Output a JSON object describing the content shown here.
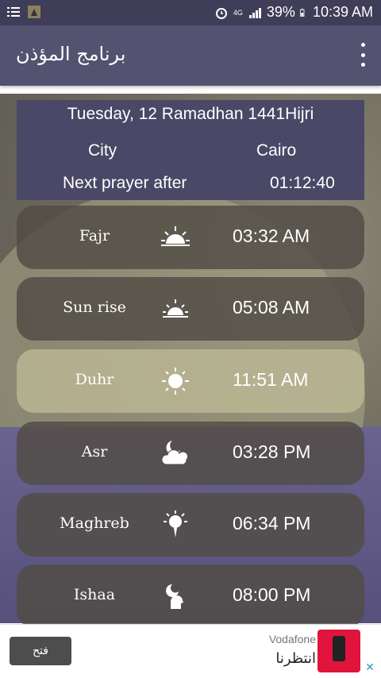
{
  "status_bar": {
    "battery": "39%",
    "time": "10:39 AM",
    "network": "4G",
    "icons": [
      "list-icon",
      "app-thumbnail-icon",
      "alarm-icon",
      "signal-icon",
      "battery-icon"
    ]
  },
  "app_bar": {
    "title": "برنامج المؤذن",
    "menu_icon": "overflow-menu-icon"
  },
  "info": {
    "date": "Tuesday, 12 Ramadhan 1441Hijri",
    "city_label": "City",
    "city_value": "Cairo",
    "next_label": "Next prayer after",
    "next_value": "01:12:40"
  },
  "prayers": [
    {
      "name": "Fajr",
      "time": "03:32 AM",
      "icon": "sunrise-icon",
      "active": false
    },
    {
      "name": "Sun rise",
      "time": "05:08 AM",
      "icon": "sunrise-icon",
      "active": false
    },
    {
      "name": "Duhr",
      "time": "11:51 AM",
      "icon": "sun-icon",
      "active": true
    },
    {
      "name": "Asr",
      "time": "03:28 PM",
      "icon": "cloud-moon-icon",
      "active": false
    },
    {
      "name": "Maghreb",
      "time": "06:34 PM",
      "icon": "sunset-icon",
      "active": false
    },
    {
      "name": "Ishaa",
      "time": "08:00 PM",
      "icon": "moon-head-icon",
      "active": false
    }
  ],
  "ad": {
    "button_label": "فتح",
    "brand": "Vodafone",
    "message": "انتظرنا",
    "close_icon": "close-icon"
  },
  "colors": {
    "status_bar": "#3f3d57",
    "app_bar": "#545271",
    "info_panel": "#4a4866",
    "row_bg": "#504c44",
    "row_active": "#bebA96"
  }
}
